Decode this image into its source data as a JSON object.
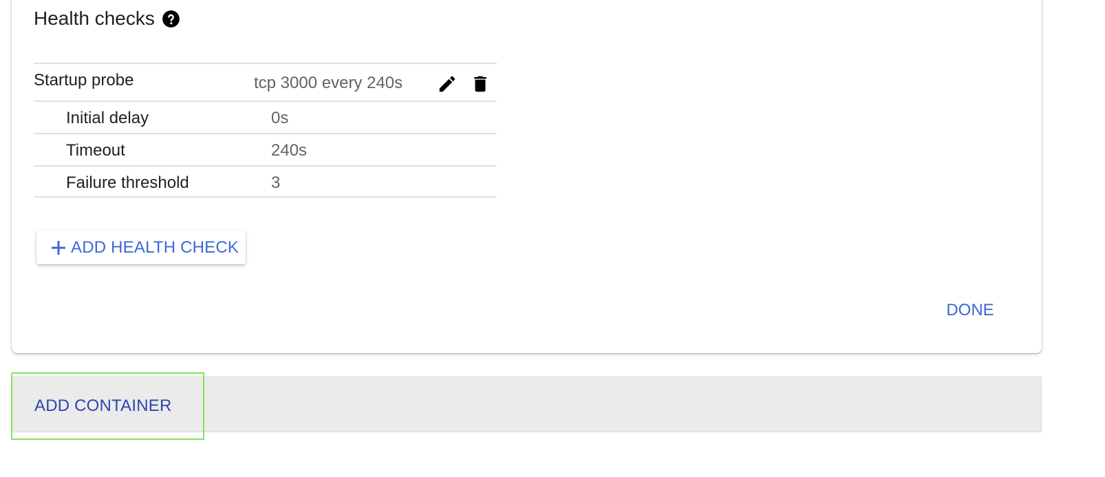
{
  "health_checks": {
    "title": "Health checks",
    "help_icon": "help-circle-icon",
    "probe": {
      "label": "Startup probe",
      "summary": "tcp 3000 every 240s",
      "edit_icon": "pencil-icon",
      "delete_icon": "trash-icon",
      "details": [
        {
          "label": "Initial delay",
          "value": "0s"
        },
        {
          "label": "Timeout",
          "value": "240s"
        },
        {
          "label": "Failure threshold",
          "value": "3"
        }
      ]
    },
    "add_button_label": "ADD HEALTH CHECK",
    "add_icon": "plus-icon",
    "done_label": "DONE"
  },
  "add_container_label": "ADD CONTAINER",
  "colors": {
    "accent": "#3b67d6",
    "add_container_text": "#2f44b0",
    "highlight": "#7ee55a",
    "bar_bg": "#ebebeb"
  }
}
